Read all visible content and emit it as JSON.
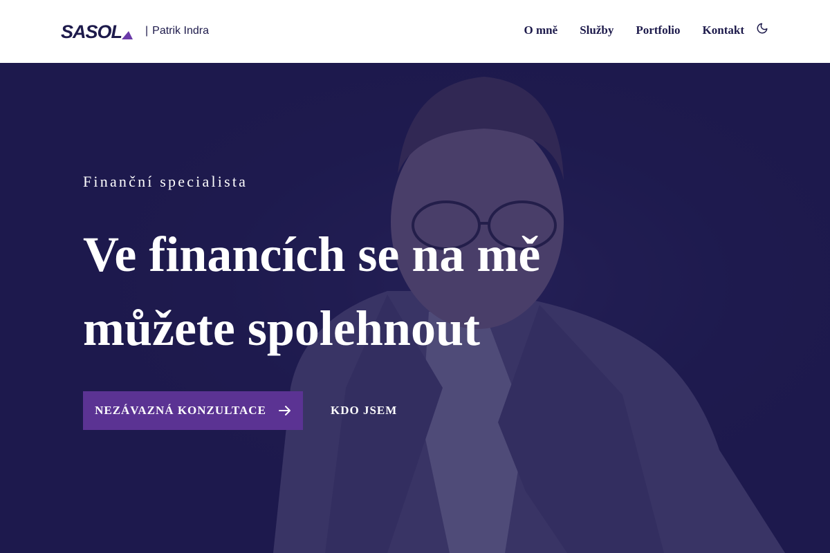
{
  "header": {
    "logo_wordmark": "SASOL",
    "logo_separator": "|",
    "logo_name": "Patrik Indra",
    "nav": [
      {
        "label": "O mně"
      },
      {
        "label": "Služby"
      },
      {
        "label": "Portfolio"
      },
      {
        "label": "Kontakt"
      }
    ],
    "theme_toggle_icon": "moon-icon"
  },
  "hero": {
    "eyebrow": "Finanční specialista",
    "headline": "Ve financích se na mě můžete spolehnout",
    "primary_cta": {
      "label": "NEZÁVAZNÁ KONZULTACE",
      "icon": "arrow-right-icon"
    },
    "secondary_cta": {
      "label": "KDO JSEM"
    },
    "background_image": "portrait of a man in glasses and a light blazer"
  },
  "colors": {
    "navy": "#1d1a4b",
    "accent_purple": "#5b3393",
    "header_bg": "#ffffff",
    "text_light": "#ffffff"
  }
}
